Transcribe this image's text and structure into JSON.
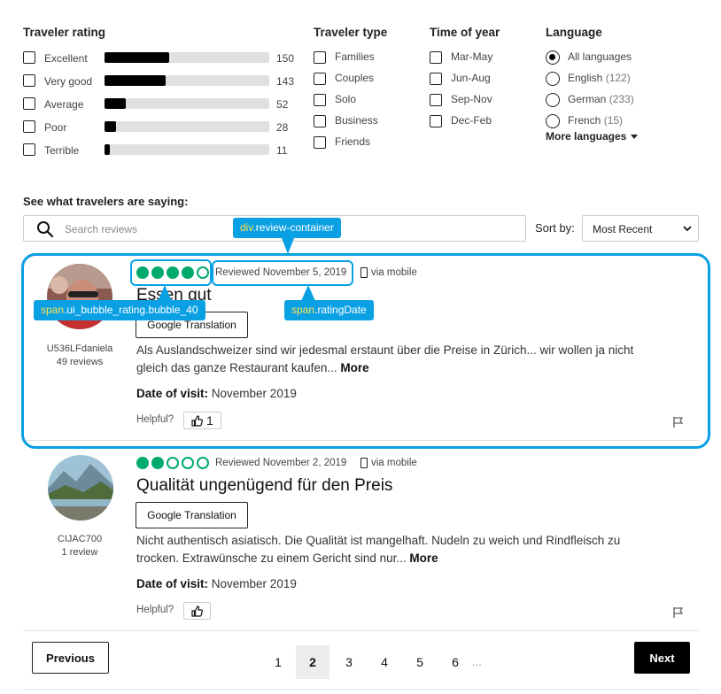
{
  "filters": {
    "traveler_rating": {
      "title": "Traveler rating",
      "items": [
        {
          "label": "Excellent",
          "count": "150",
          "fill_fraction": 0.39
        },
        {
          "label": "Very good",
          "count": "143",
          "fill_fraction": 0.37
        },
        {
          "label": "Average",
          "count": "52",
          "fill_fraction": 0.13
        },
        {
          "label": "Poor",
          "count": "28",
          "fill_fraction": 0.07
        },
        {
          "label": "Terrible",
          "count": "11",
          "fill_fraction": 0.03
        }
      ]
    },
    "traveler_type": {
      "title": "Traveler type",
      "items": [
        "Families",
        "Couples",
        "Solo",
        "Business",
        "Friends"
      ]
    },
    "time_of_year": {
      "title": "Time of year",
      "items": [
        "Mar-May",
        "Jun-Aug",
        "Sep-Nov",
        "Dec-Feb"
      ]
    },
    "language": {
      "title": "Language",
      "items": [
        {
          "label": "All languages",
          "count": "",
          "checked": true
        },
        {
          "label": "English",
          "count": "(122)",
          "checked": false
        },
        {
          "label": "German",
          "count": "(233)",
          "checked": false
        },
        {
          "label": "French",
          "count": "(15)",
          "checked": false
        }
      ],
      "more_label": "More languages"
    }
  },
  "reviews_header": {
    "title": "See what travelers are saying:",
    "search_placeholder": "Search reviews",
    "sort_label": "Sort by:",
    "sort_value": "Most Recent"
  },
  "reviews": [
    {
      "username": "U536LFdaniela",
      "user_reviews": "49 reviews",
      "rating": 4,
      "date": "Reviewed November 5, 2019",
      "via": "via mobile",
      "title": "Essen gut",
      "translate_label": "Google Translation",
      "text": "Als Auslandschweizer sind wir jedesmal erstaunt über die Preise in Zürich... wir wollen ja nicht gleich das ganze Restaurant kaufen...",
      "more_label": "More",
      "date_of_visit_label": "Date of visit:",
      "date_of_visit": "November 2019",
      "helpful_label": "Helpful?",
      "helpful_count": "1"
    },
    {
      "username": "CIJAC700",
      "user_reviews": "1 review",
      "rating": 2,
      "date": "Reviewed November 2, 2019",
      "via": "via mobile",
      "title": "Qualität ungenügend für den Preis",
      "translate_label": "Google Translation",
      "text": "Nicht authentisch asiatisch. Die Qualität ist mangelhaft. Nudeln zu weich und Rindfleisch zu trocken. Extrawünsche zu einem Gericht sind nur...",
      "more_label": "More",
      "date_of_visit_label": "Date of visit:",
      "date_of_visit": "November 2019",
      "helpful_label": "Helpful?",
      "helpful_count": ""
    }
  ],
  "annotations": {
    "container_tag_key": "div",
    "container_tag_value": ".review-container",
    "bubble_tag_key": "span",
    "bubble_tag_value": ".ui_bubble_rating.bubble_40",
    "date_tag_key": "span",
    "date_tag_value": ".ratingDate",
    "highlight_color": "#0aa0e4"
  },
  "pagination": {
    "previous_label": "Previous",
    "next_label": "Next",
    "pages": [
      "1",
      "2",
      "3",
      "4",
      "5",
      "6"
    ],
    "current_page": "2",
    "ellipsis": "..."
  },
  "colors": {
    "bubble_green": "#00aa6c",
    "bar_fill": "#000000",
    "bar_track": "#e0e0e0"
  },
  "icons": [
    "search-icon",
    "chevron-down-icon",
    "phone-icon",
    "thumbs-up-icon",
    "flag-icon"
  ]
}
